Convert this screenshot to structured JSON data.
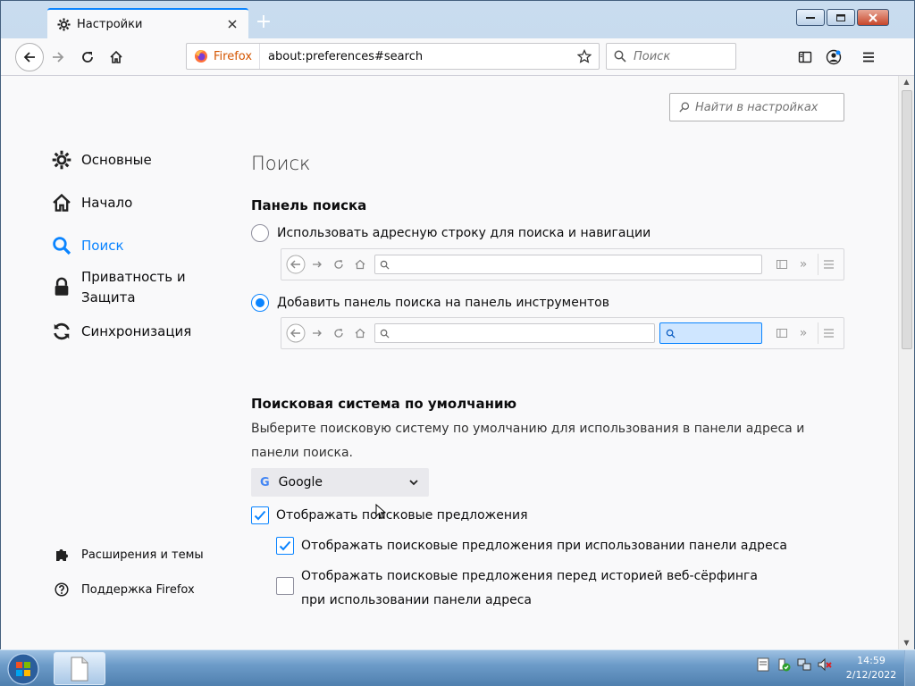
{
  "tab": {
    "title": "Настройки"
  },
  "window_controls": {
    "minimize": "—",
    "maximize": "□",
    "close": "✕"
  },
  "navbar": {
    "identity_label": "Firefox",
    "url": "about:preferences#search",
    "search_placeholder": "Поиск"
  },
  "prefs": {
    "find_placeholder": "Найти в настройках",
    "sidebar": {
      "items": [
        {
          "label": "Основные",
          "icon": "gear-icon"
        },
        {
          "label": "Начало",
          "icon": "home-icon"
        },
        {
          "label": "Поиск",
          "icon": "search-icon",
          "selected": true
        },
        {
          "label": "Приватность и Защита",
          "icon": "lock-icon"
        },
        {
          "label": "Синхронизация",
          "icon": "sync-icon"
        }
      ],
      "extensions": "Расширения и темы",
      "support": "Поддержка Firefox"
    },
    "page_title": "Поиск",
    "search_bar_section": {
      "heading": "Панель поиска",
      "option_urlbar": "Использовать адресную строку для поиска и навигации",
      "option_searchbar": "Добавить панель поиска на панель инструментов",
      "selected": "option_searchbar"
    },
    "default_engine_section": {
      "heading": "Поисковая система по умолчанию",
      "description": "Выберите поисковую систему по умолчанию для использования в панели адреса и панели поиска.",
      "engine_letter": "G",
      "engine": "Google",
      "suggestions": {
        "label": "Отображать поисковые предложения",
        "checked": true
      },
      "suggestions_urlbar": {
        "label": "Отображать поисковые предложения при использовании панели адреса",
        "checked": true
      },
      "suggestions_before_history": {
        "label": "Отображать поисковые предложения перед историей веб-сёрфинга при использовании панели адреса",
        "checked": false
      }
    }
  },
  "taskbar": {
    "time": "14:59",
    "date": "2/12/2022"
  },
  "colors": {
    "accent": "#0a84ff",
    "page_bg": "#f9f9fa",
    "chrome_bg": "#c9dcef"
  }
}
